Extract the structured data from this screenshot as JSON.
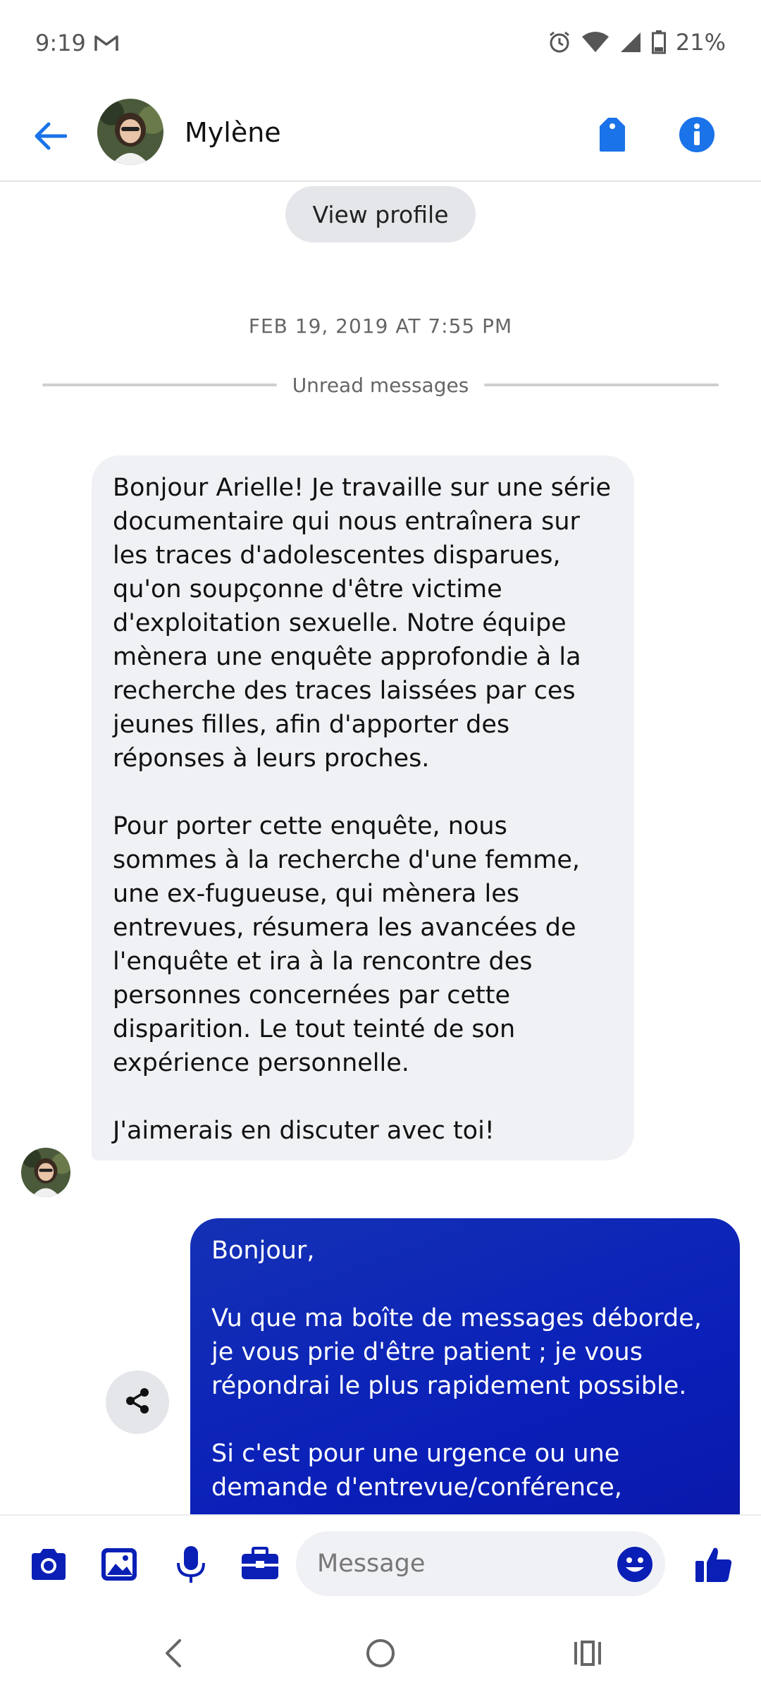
{
  "status_bar": {
    "time": "9:19",
    "battery": "21%",
    "icons": [
      "gmail-icon",
      "alarm-icon",
      "wifi-icon",
      "signal-icon",
      "battery-icon"
    ]
  },
  "header": {
    "contact_name": "Mylène",
    "icons": [
      "back-arrow-icon",
      "tag-icon",
      "info-icon"
    ],
    "accent_color": "#1a73e8"
  },
  "conversation": {
    "view_profile_label": "View profile",
    "timestamp": "FEB 19, 2019 AT 7:55 PM",
    "unread_label": "Unread messages",
    "incoming_message": "Bonjour Arielle! Je travaille sur une série documentaire qui nous entraînera sur les traces d'adolescentes disparues, qu'on soupçonne d'être victime d'exploitation sexuelle. Notre équipe mènera une enquête approfondie à la recherche des traces laissées par ces jeunes filles, afin d'apporter des réponses à leurs proches.\n\nPour porter cette enquête, nous sommes à la recherche d'une femme, une ex-fugueuse, qui mènera les entrevues, résumera les avancées de l'enquête et ira à la rencontre des personnes concernées par cette disparition. Le tout teinté de son expérience personnelle.\n\nJ'aimerais en discuter avec toi!",
    "outgoing_message": "Bonjour,\n\nVu que ma boîte de messages déborde, je vous prie d'être patient ; je vous répondrai le plus rapidement possible.\n\nSi c'est pour une urgence ou une demande d'entrevue/conférence,",
    "outgoing_color": "#0b1fb5",
    "incoming_color": "#f0f1f4"
  },
  "composer": {
    "placeholder": "Message",
    "icons": [
      "camera-icon",
      "gallery-icon",
      "microphone-icon",
      "briefcase-icon",
      "emoji-icon",
      "thumbs-up-icon"
    ],
    "icon_color": "#0a1fb5"
  },
  "nav_bar": {
    "icons": [
      "back-nav-icon",
      "home-nav-icon",
      "recents-nav-icon"
    ]
  }
}
